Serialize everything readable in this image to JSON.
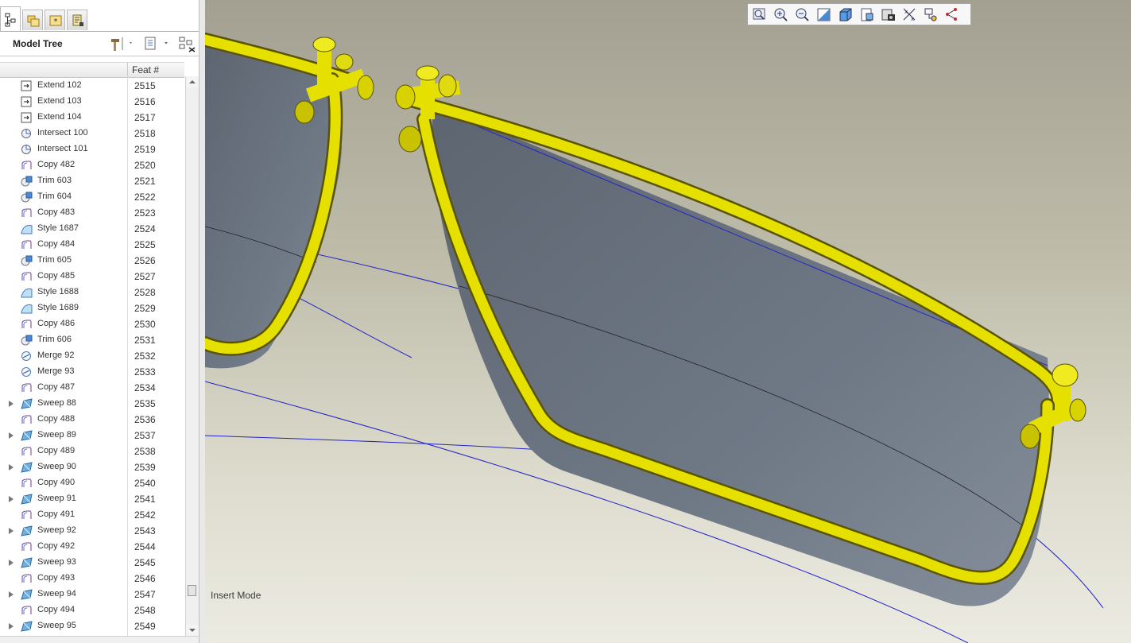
{
  "tabs": [
    {
      "name": "model-tree-tab-icon",
      "active": true
    },
    {
      "name": "folder-browser-tab-icon",
      "active": false
    },
    {
      "name": "favorites-tab-icon",
      "active": false
    },
    {
      "name": "layer-tab-icon",
      "active": false
    }
  ],
  "model_tree": {
    "title": "Model Tree",
    "column_feat": "Feat #",
    "header_icons": [
      "hammer-settings-icon",
      "tree-filters-icon",
      "show-hide-icon"
    ],
    "rows": [
      {
        "label": "Extend 102",
        "feat": "2515",
        "icon": "extend",
        "expandable": false
      },
      {
        "label": "Extend 103",
        "feat": "2516",
        "icon": "extend",
        "expandable": false
      },
      {
        "label": "Extend 104",
        "feat": "2517",
        "icon": "extend",
        "expandable": false
      },
      {
        "label": "Intersect 100",
        "feat": "2518",
        "icon": "intersect",
        "expandable": false
      },
      {
        "label": "Intersect 101",
        "feat": "2519",
        "icon": "intersect",
        "expandable": false
      },
      {
        "label": "Copy 482",
        "feat": "2520",
        "icon": "copy",
        "expandable": false
      },
      {
        "label": "Trim 603",
        "feat": "2521",
        "icon": "trim",
        "expandable": false
      },
      {
        "label": "Trim 604",
        "feat": "2522",
        "icon": "trim",
        "expandable": false
      },
      {
        "label": "Copy 483",
        "feat": "2523",
        "icon": "copy",
        "expandable": false
      },
      {
        "label": "Style 1687",
        "feat": "2524",
        "icon": "style",
        "expandable": false
      },
      {
        "label": "Copy 484",
        "feat": "2525",
        "icon": "copy",
        "expandable": false
      },
      {
        "label": "Trim 605",
        "feat": "2526",
        "icon": "trim",
        "expandable": false
      },
      {
        "label": "Copy 485",
        "feat": "2527",
        "icon": "copy",
        "expandable": false
      },
      {
        "label": "Style 1688",
        "feat": "2528",
        "icon": "style",
        "expandable": false
      },
      {
        "label": "Style 1689",
        "feat": "2529",
        "icon": "style",
        "expandable": false
      },
      {
        "label": "Copy 486",
        "feat": "2530",
        "icon": "copy",
        "expandable": false
      },
      {
        "label": "Trim 606",
        "feat": "2531",
        "icon": "trim",
        "expandable": false
      },
      {
        "label": "Merge 92",
        "feat": "2532",
        "icon": "merge",
        "expandable": false
      },
      {
        "label": "Merge 93",
        "feat": "2533",
        "icon": "merge",
        "expandable": false
      },
      {
        "label": "Copy 487",
        "feat": "2534",
        "icon": "copy",
        "expandable": false
      },
      {
        "label": "Sweep 88",
        "feat": "2535",
        "icon": "sweep",
        "expandable": true
      },
      {
        "label": "Copy 488",
        "feat": "2536",
        "icon": "copy",
        "expandable": false
      },
      {
        "label": "Sweep 89",
        "feat": "2537",
        "icon": "sweep",
        "expandable": true
      },
      {
        "label": "Copy 489",
        "feat": "2538",
        "icon": "copy",
        "expandable": false
      },
      {
        "label": "Sweep 90",
        "feat": "2539",
        "icon": "sweep",
        "expandable": true
      },
      {
        "label": "Copy 490",
        "feat": "2540",
        "icon": "copy",
        "expandable": false
      },
      {
        "label": "Sweep 91",
        "feat": "2541",
        "icon": "sweep",
        "expandable": true
      },
      {
        "label": "Copy 491",
        "feat": "2542",
        "icon": "copy",
        "expandable": false
      },
      {
        "label": "Sweep 92",
        "feat": "2543",
        "icon": "sweep",
        "expandable": true
      },
      {
        "label": "Copy 492",
        "feat": "2544",
        "icon": "copy",
        "expandable": false
      },
      {
        "label": "Sweep 93",
        "feat": "2545",
        "icon": "sweep",
        "expandable": true
      },
      {
        "label": "Copy 493",
        "feat": "2546",
        "icon": "copy",
        "expandable": false
      },
      {
        "label": "Sweep 94",
        "feat": "2547",
        "icon": "sweep",
        "expandable": true
      },
      {
        "label": "Copy 494",
        "feat": "2548",
        "icon": "copy",
        "expandable": false
      },
      {
        "label": "Sweep 95",
        "feat": "2549",
        "icon": "sweep",
        "expandable": true
      }
    ]
  },
  "view_toolbar": [
    "refit-icon",
    "zoom-in-icon",
    "zoom-out-icon",
    "repaint-icon",
    "display-style-icon",
    "saved-views-icon",
    "view-manager-icon",
    "datum-display-icon",
    "spin-center-icon",
    "annotation-display-icon"
  ],
  "viewport": {
    "status_text": "Insert Mode",
    "colors": {
      "tube": "#e6e000",
      "surface": "#727c88",
      "curve": "#2323c8"
    }
  }
}
